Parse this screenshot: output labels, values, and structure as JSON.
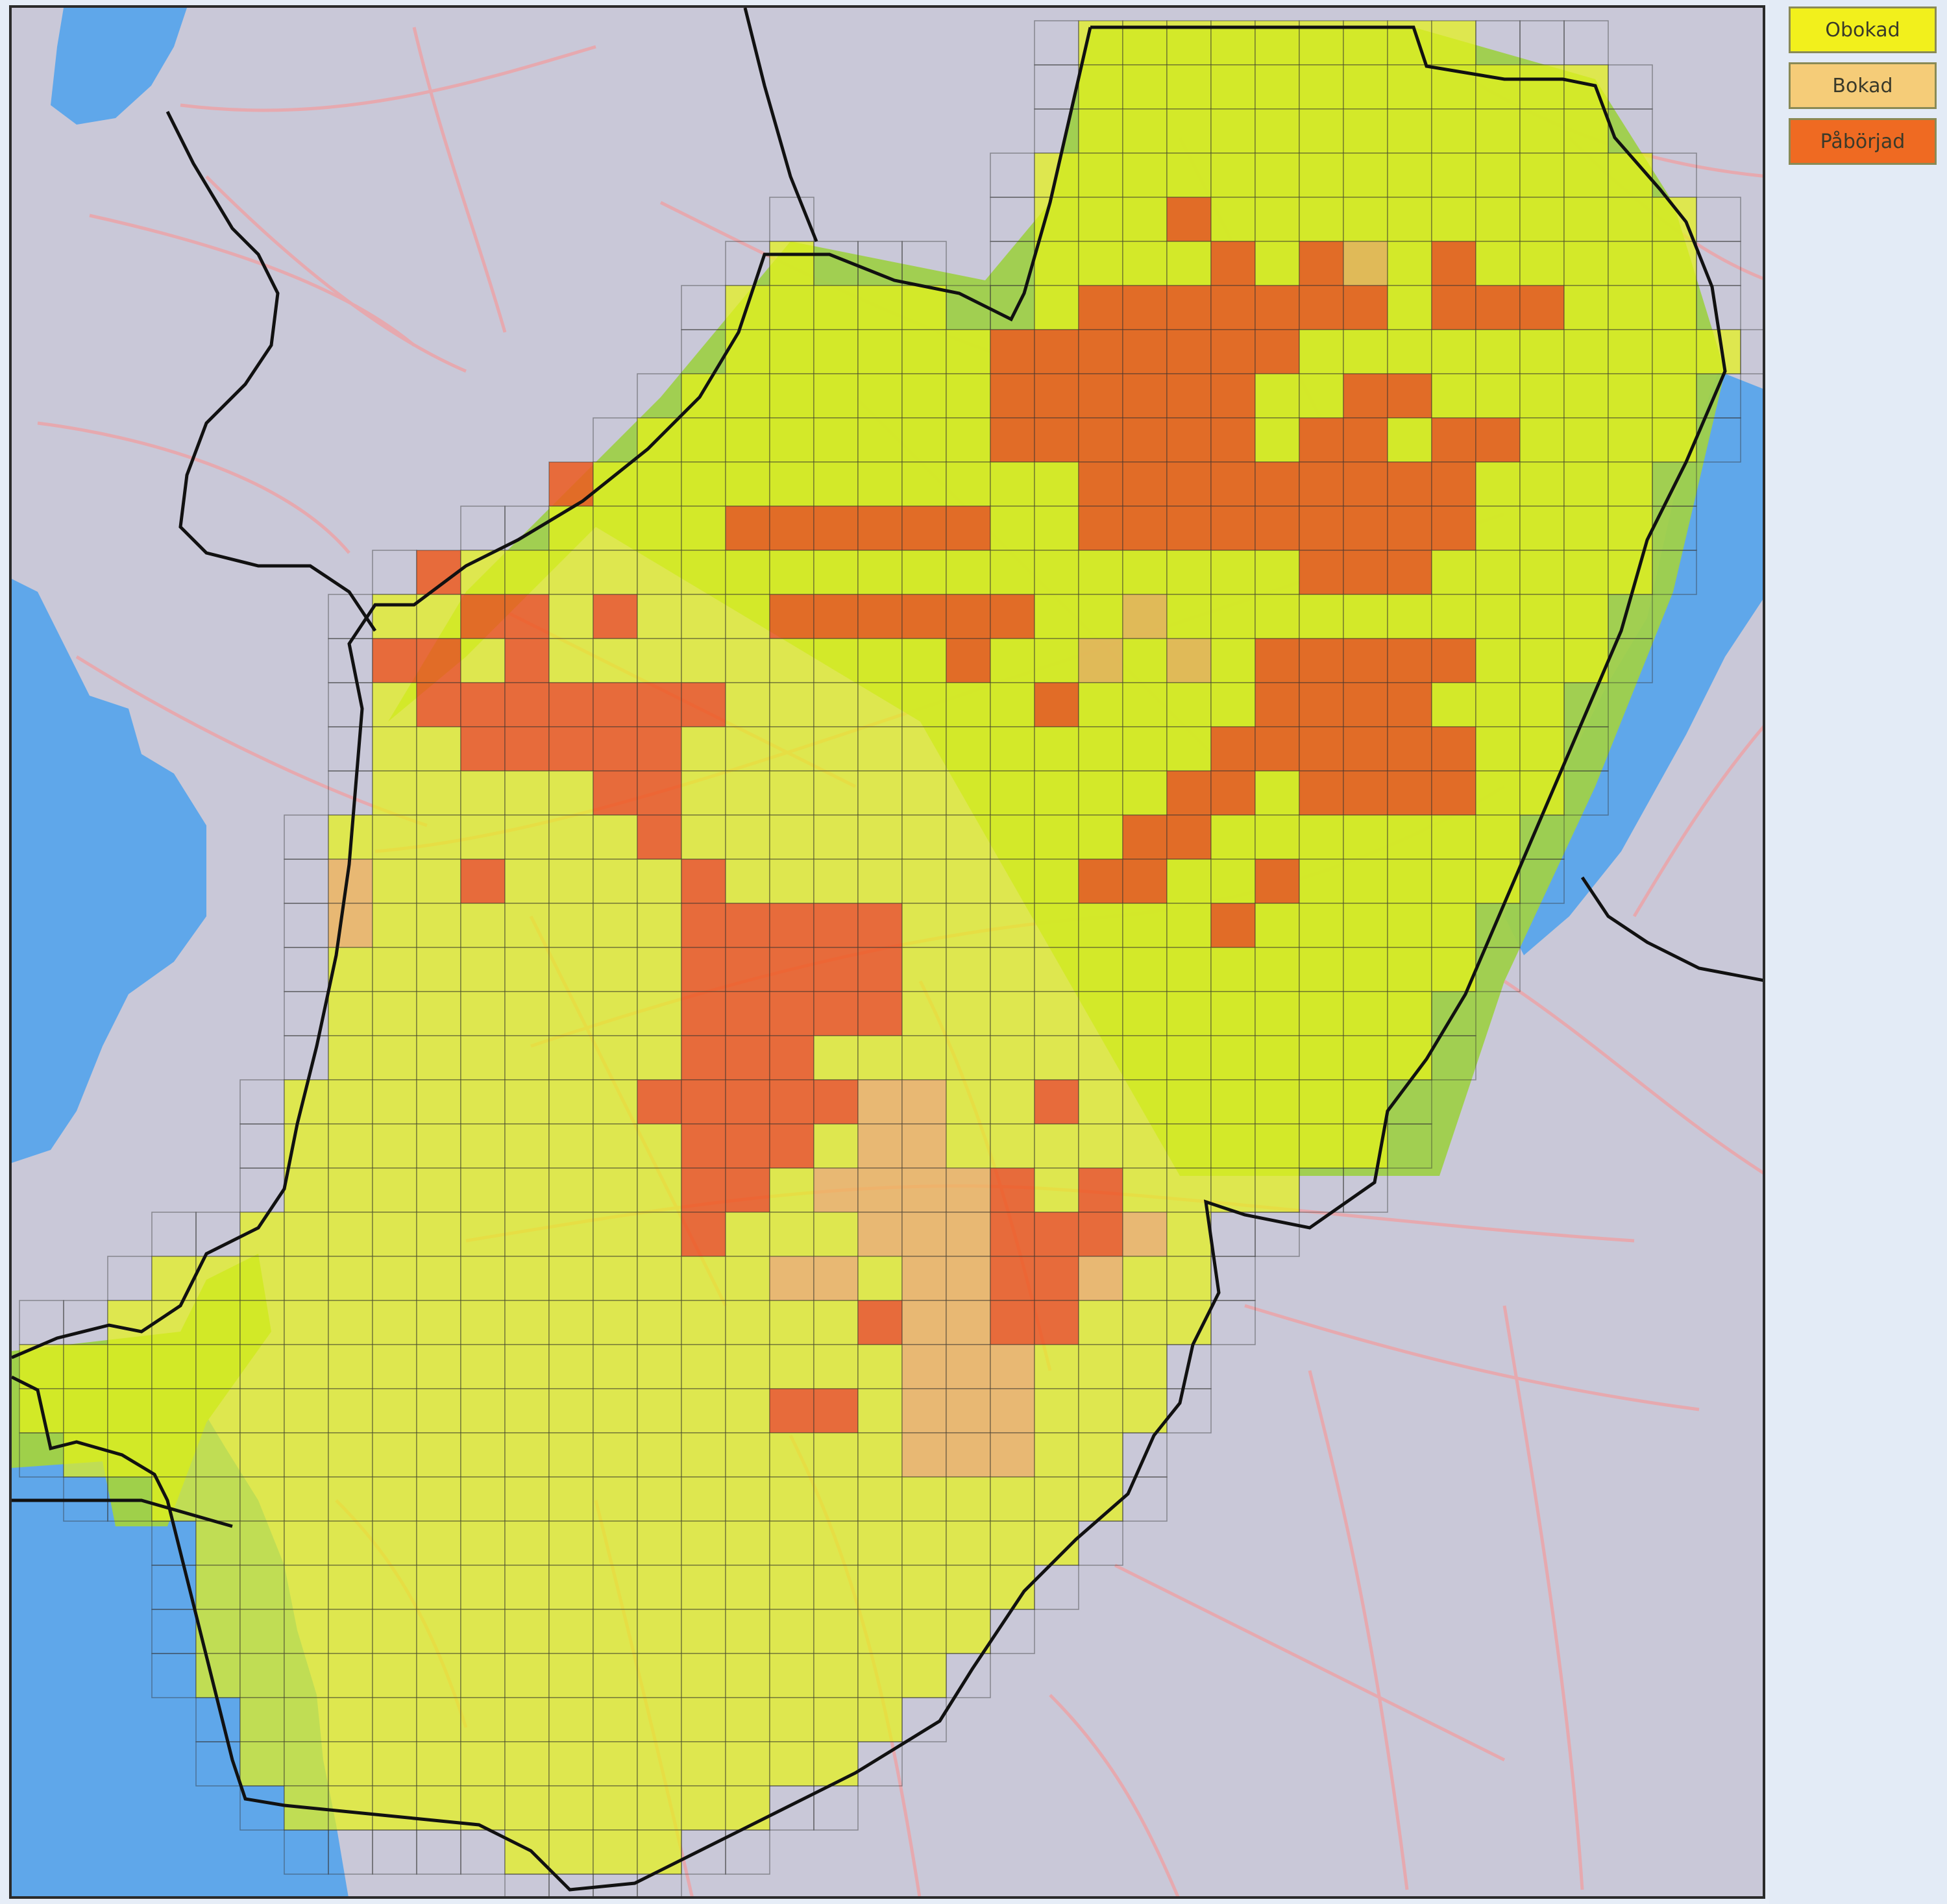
{
  "map": {
    "colors": {
      "background": "#c9c8d8",
      "sea": "#5fa7ea",
      "road": "#e8a8ad",
      "border": "#111111",
      "grid": "#333333",
      "forest": "#9fd04a",
      "unbooked": "#e6f21a",
      "booked": "#f0b45a",
      "started": "#ec5a20"
    }
  },
  "legend": {
    "items": [
      {
        "label": "Obokad",
        "color": "#f2f01c"
      },
      {
        "label": "Bokad",
        "color": "#f5cc78"
      },
      {
        "label": "Påbörjad",
        "color": "#ef6a22"
      }
    ]
  }
}
